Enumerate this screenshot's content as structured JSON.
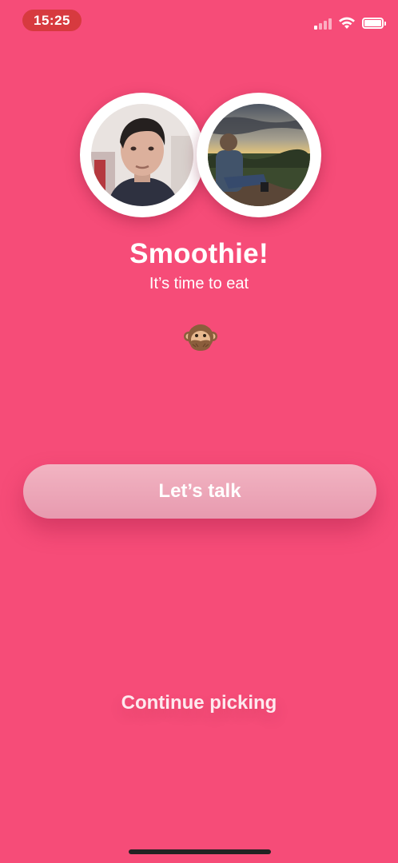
{
  "status_bar": {
    "time": "15:25",
    "signal_icon": "cellular-signal-icon",
    "wifi_icon": "wifi-icon",
    "battery_icon": "battery-icon",
    "signal_level": 0.25,
    "battery_level": 1.0
  },
  "match": {
    "title": "Smoothie!",
    "subtitle": "It’s time to eat",
    "emoji": "🙊",
    "emoji_icon": "speak-no-evil-monkey-icon"
  },
  "actions": {
    "talk_label": "Let’s talk",
    "continue_label": "Continue picking"
  },
  "colors": {
    "background": "#f64c78",
    "time_pill": "#d73a3f",
    "button": "#ecabbb"
  }
}
